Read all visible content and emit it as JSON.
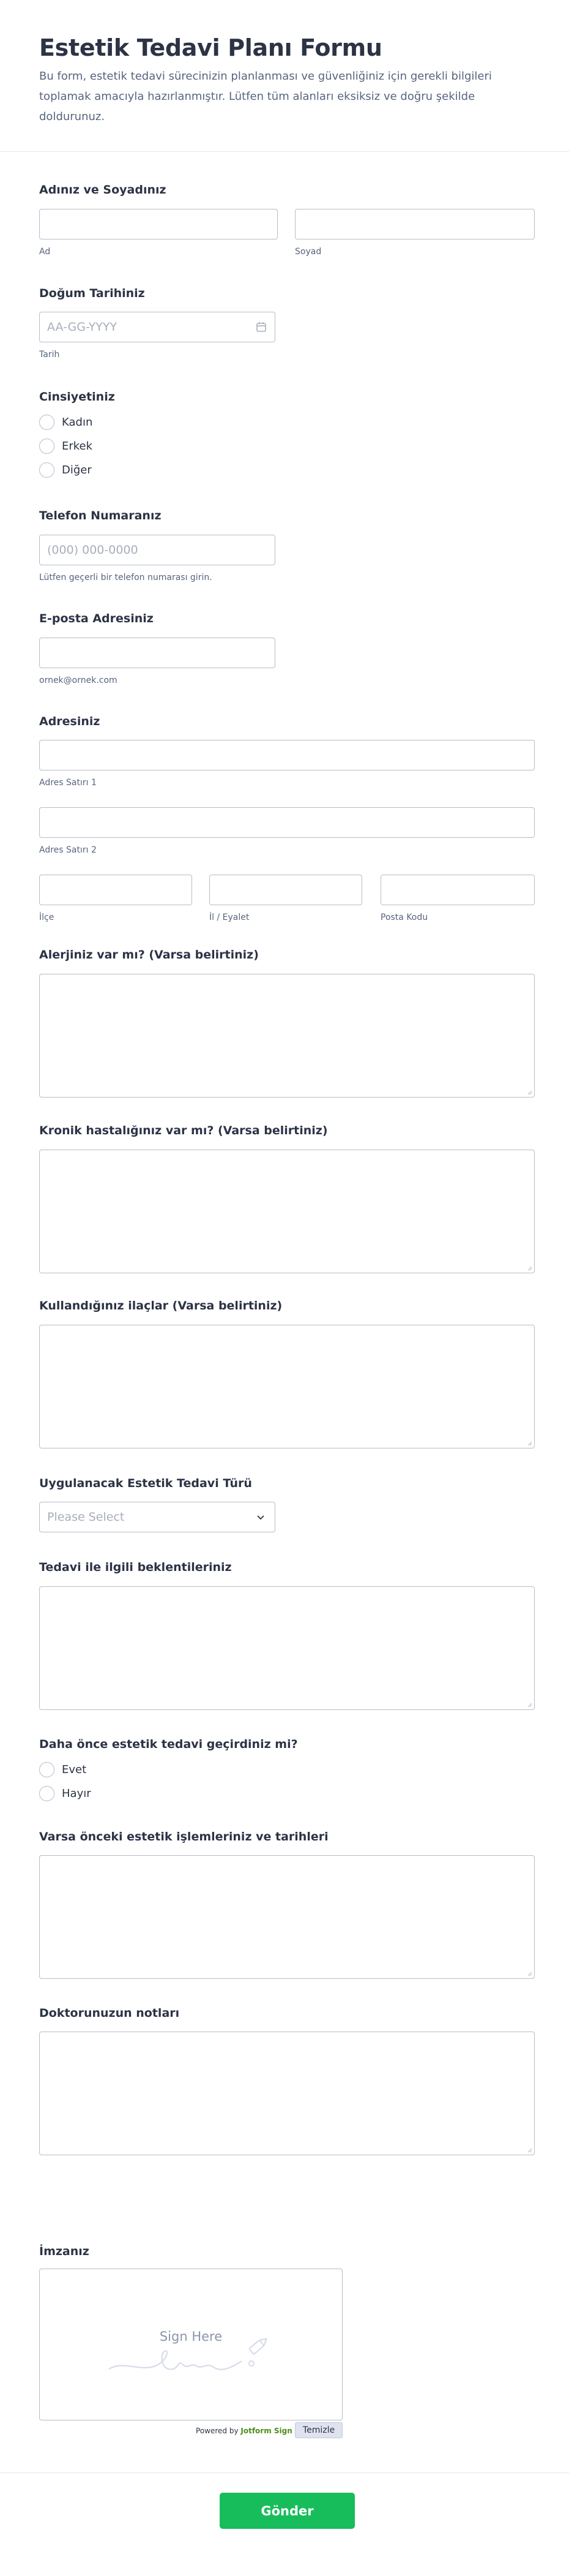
{
  "form": {
    "title": "Estetik Tedavi Planı Formu",
    "description": "Bu form, estetik tedavi sürecinizin planlanması ve güvenliğiniz için gerekli bilgileri toplamak amacıyla hazırlanmıştır. Lütfen tüm alanları eksiksiz ve doğru şekilde doldurunuz."
  },
  "name": {
    "label": "Adınız ve Soyadınız",
    "first_sublabel": "Ad",
    "last_sublabel": "Soyad"
  },
  "birth": {
    "label": "Doğum Tarihiniz",
    "placeholder": "AA-GG-YYYY",
    "sublabel": "Tarih"
  },
  "gender": {
    "label": "Cinsiyetiniz",
    "options": [
      "Kadın",
      "Erkek",
      "Diğer"
    ]
  },
  "phone": {
    "label": "Telefon Numaranız",
    "placeholder": "(000) 000-0000",
    "sublabel": "Lütfen geçerli bir telefon numarası girin."
  },
  "email": {
    "label": "E-posta Adresiniz",
    "sublabel": "ornek@ornek.com"
  },
  "address": {
    "label": "Adresiniz",
    "line1_sublabel": "Adres Satırı 1",
    "line2_sublabel": "Adres Satırı 2",
    "district_sublabel": "İlçe",
    "city_sublabel": "İl / Eyalet",
    "postal_sublabel": "Posta Kodu"
  },
  "allergy": {
    "label": "Alerjiniz var mı? (Varsa belirtiniz)"
  },
  "chronic": {
    "label": "Kronik hastalığınız var mı? (Varsa belirtiniz)"
  },
  "meds": {
    "label": "Kullandığınız ilaçlar (Varsa belirtiniz)"
  },
  "treatment": {
    "label": "Uygulanacak Estetik Tedavi Türü",
    "selected": "Please Select"
  },
  "expectations": {
    "label": "Tedavi ile ilgili beklentileriniz"
  },
  "previous": {
    "label": "Daha önce estetik tedavi geçirdiniz mi?",
    "options": [
      "Evet",
      "Hayır"
    ]
  },
  "previous_details": {
    "label": "Varsa önceki estetik işlemleriniz ve tarihleri"
  },
  "doctor_notes": {
    "label": "Doktorunuzun notları"
  },
  "signature": {
    "label": "İmzanız",
    "placeholder": "Sign Here",
    "powered_prefix": "Powered by",
    "powered_brand": "Jotform Sign",
    "clear_label": "Temizle"
  },
  "submit_label": "Gönder",
  "colors": {
    "accent": "#18bd5b",
    "text": "#2c3345",
    "muted": "#57647e",
    "border": "#b8bdc9"
  },
  "icons": [
    "calendar-icon",
    "chevron-down-icon",
    "signature-pen-icon"
  ]
}
